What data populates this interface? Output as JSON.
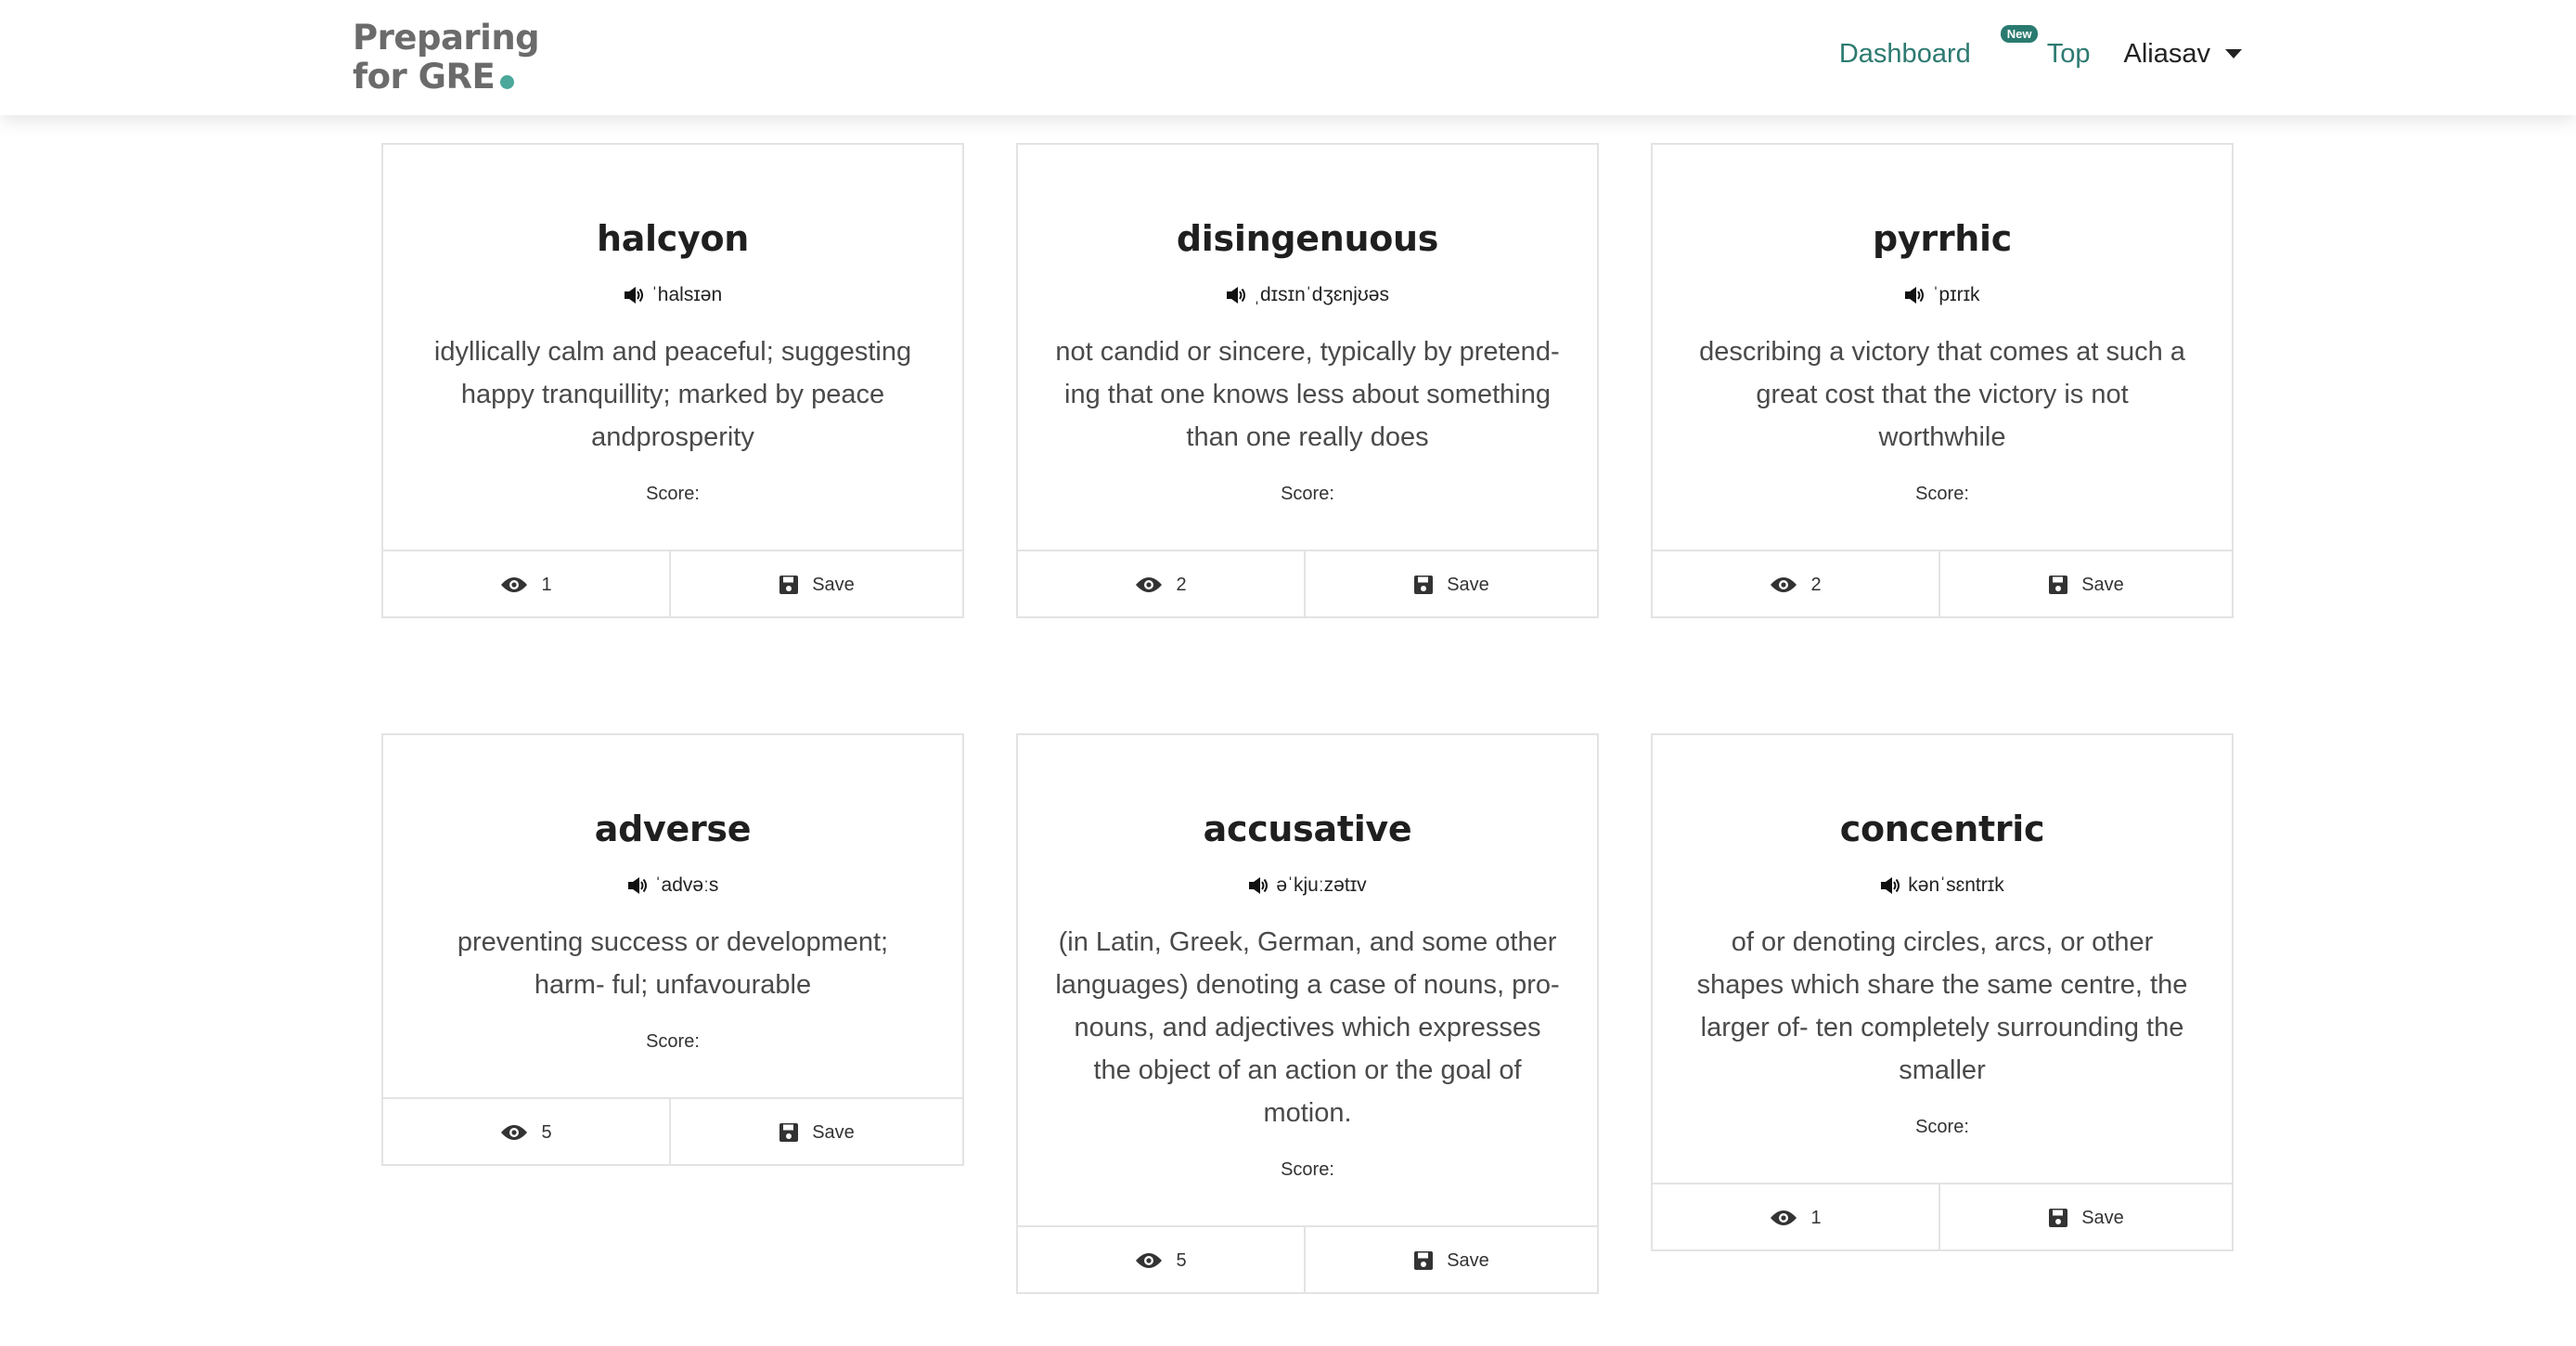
{
  "brand": {
    "line1": "Preparing",
    "line2": "for GRE",
    "accent_color": "#4ba89a"
  },
  "nav": {
    "dashboard": "Dashboard",
    "top_badge": "New",
    "top": "Top",
    "user": "Aliasav",
    "link_color": "#2c7a70"
  },
  "labels": {
    "score": "Score:",
    "save": "Save"
  },
  "cards": [
    {
      "word": "halcyon",
      "phonetic": "ˈhalsɪən",
      "definition": "idyllically calm and peaceful; suggesting happy tranquillity; marked by peace andprosperity",
      "views": "1"
    },
    {
      "word": "disingenuous",
      "phonetic": "ˌdɪsɪnˈdʒɛnjʊəs",
      "definition": "not candid or sincere, typically by pretend- ing that one knows less about something than one really does",
      "views": "2"
    },
    {
      "word": "pyrrhic",
      "phonetic": "ˈpɪrɪk",
      "definition": "describing a victory that comes at such a great cost that the victory is not worthwhile",
      "views": "2"
    },
    {
      "word": "adverse",
      "phonetic": "ˈadvəːs",
      "definition": "preventing success or development; harm- ful; unfavourable",
      "views": "5"
    },
    {
      "word": "accusative",
      "phonetic": "əˈkjuːzətɪv",
      "definition": "(in Latin, Greek, German, and some other languages) denoting a case of nouns, pro- nouns, and adjectives which expresses the object of an action or the goal of motion.",
      "views": "5"
    },
    {
      "word": "concentric",
      "phonetic": "kənˈsɛntrɪk",
      "definition": "of or denoting circles, arcs, or other shapes which share the same centre, the larger of- ten completely surrounding the smaller",
      "views": "1"
    }
  ]
}
